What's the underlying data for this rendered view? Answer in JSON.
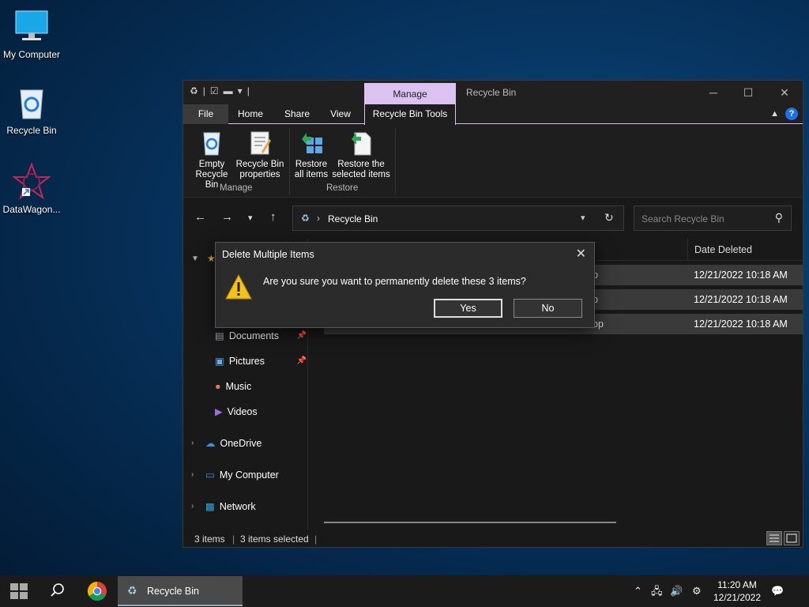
{
  "desktop": {
    "icons": [
      {
        "label": "My Computer"
      },
      {
        "label": "Recycle Bin"
      },
      {
        "label": "DataWagon..."
      }
    ]
  },
  "window": {
    "title": "Recycle Bin",
    "manage_tab": "Manage",
    "tabs": {
      "file": "File",
      "home": "Home",
      "share": "Share",
      "view": "View",
      "tools": "Recycle Bin Tools"
    },
    "ribbon": {
      "empty_line1": "Empty",
      "empty_line2": "Recycle Bin",
      "props_line1": "Recycle Bin",
      "props_line2": "properties",
      "restore_all_line1": "Restore",
      "restore_all_line2": "all items",
      "restore_sel_line1": "Restore the",
      "restore_sel_line2": "selected items",
      "group_manage": "Manage",
      "group_restore": "Restore"
    },
    "address": {
      "path": "Recycle Bin",
      "search_placeholder": "Search Recycle Bin"
    },
    "nav": {
      "documents": "Documents",
      "pictures": "Pictures",
      "music": "Music",
      "videos": "Videos",
      "onedrive": "OneDrive",
      "my_computer": "My Computer",
      "network": "Network"
    },
    "columns": {
      "date_deleted": "Date Deleted"
    },
    "rows": [
      {
        "location_fragment": "p",
        "date": "12/21/2022 10:18 AM"
      },
      {
        "location_fragment": "p",
        "date": "12/21/2022 10:18 AM"
      },
      {
        "location_fragment": "op",
        "date": "12/21/2022 10:18 AM"
      }
    ],
    "status": {
      "count": "3 items",
      "selected": "3 items selected"
    }
  },
  "dialog": {
    "title": "Delete Multiple Items",
    "message": "Are you sure you want to permanently delete these 3 items?",
    "yes": "Yes",
    "no": "No"
  },
  "taskbar": {
    "active_app": "Recycle Bin",
    "time": "11:20 AM",
    "date": "12/21/2022"
  }
}
